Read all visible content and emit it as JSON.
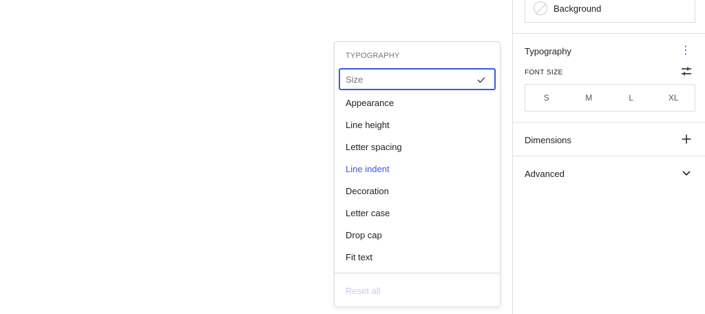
{
  "sidebar": {
    "background_label": "Background",
    "typography_title": "Typography",
    "font_size_label": "FONT SIZE",
    "font_sizes": [
      "S",
      "M",
      "L",
      "XL"
    ],
    "dimensions_title": "Dimensions",
    "advanced_title": "Advanced"
  },
  "dropdown": {
    "heading": "TYPOGRAPHY",
    "items": [
      {
        "label": "Size",
        "state": "selected"
      },
      {
        "label": "Appearance",
        "state": "normal"
      },
      {
        "label": "Line height",
        "state": "normal"
      },
      {
        "label": "Letter spacing",
        "state": "normal"
      },
      {
        "label": "Line indent",
        "state": "active"
      },
      {
        "label": "Decoration",
        "state": "normal"
      },
      {
        "label": "Letter case",
        "state": "normal"
      },
      {
        "label": "Drop cap",
        "state": "normal"
      },
      {
        "label": "Fit text",
        "state": "normal"
      }
    ],
    "reset_label": "Reset all"
  },
  "colors": {
    "accent": "#3858e9",
    "disabled": "#c3cdf4"
  },
  "icons": {
    "swatch": "no-color-swatch-icon",
    "more": "kebab-menu-icon",
    "settings": "sliders-icon",
    "add": "plus-icon",
    "expand": "chevron-down-icon",
    "selected": "check-icon"
  }
}
